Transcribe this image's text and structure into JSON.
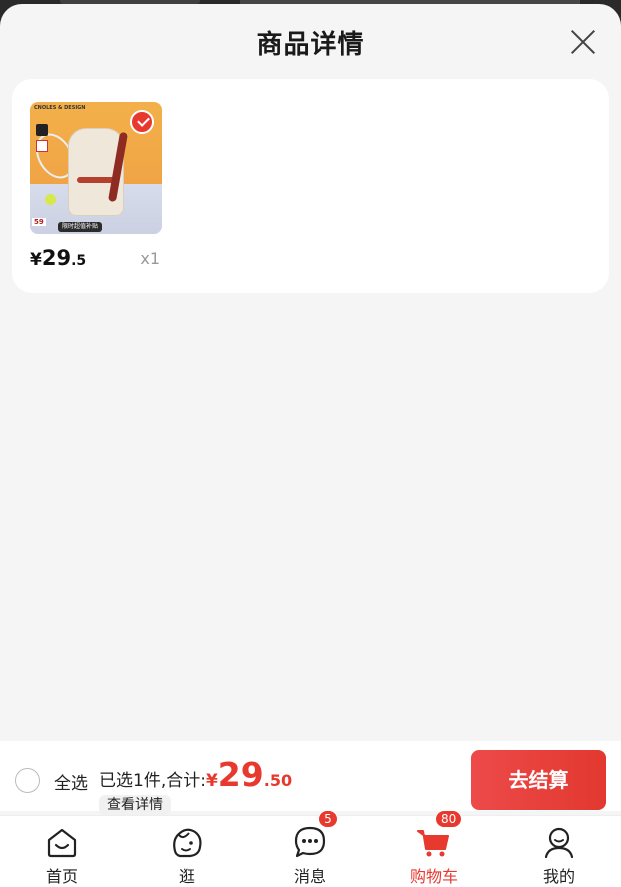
{
  "sheet": {
    "title": "商品详情"
  },
  "product": {
    "thumb_brand": "CNOLES & DESIGN",
    "thumb_price": "59",
    "thumb_promo": "限时超值补贴",
    "price_symbol": "¥",
    "price_int": "29",
    "price_dec": ".5",
    "quantity": "x1",
    "selected": true
  },
  "checkout": {
    "select_all_label": "全选",
    "summary_text": "已选1件,合计:",
    "total_symbol": "¥",
    "total_int": "29",
    "total_dec": ".50",
    "view_detail_label": "查看详情",
    "checkout_label": "去结算"
  },
  "tabs": [
    {
      "label": "首页",
      "icon": "home-icon"
    },
    {
      "label": "逛",
      "icon": "explore-icon"
    },
    {
      "label": "消息",
      "icon": "message-icon",
      "badge": "5"
    },
    {
      "label": "购物车",
      "icon": "cart-icon",
      "badge": "80",
      "active": true
    },
    {
      "label": "我的",
      "icon": "profile-icon"
    }
  ],
  "colors": {
    "accent": "#e8392f",
    "background": "#f5f5f5"
  }
}
